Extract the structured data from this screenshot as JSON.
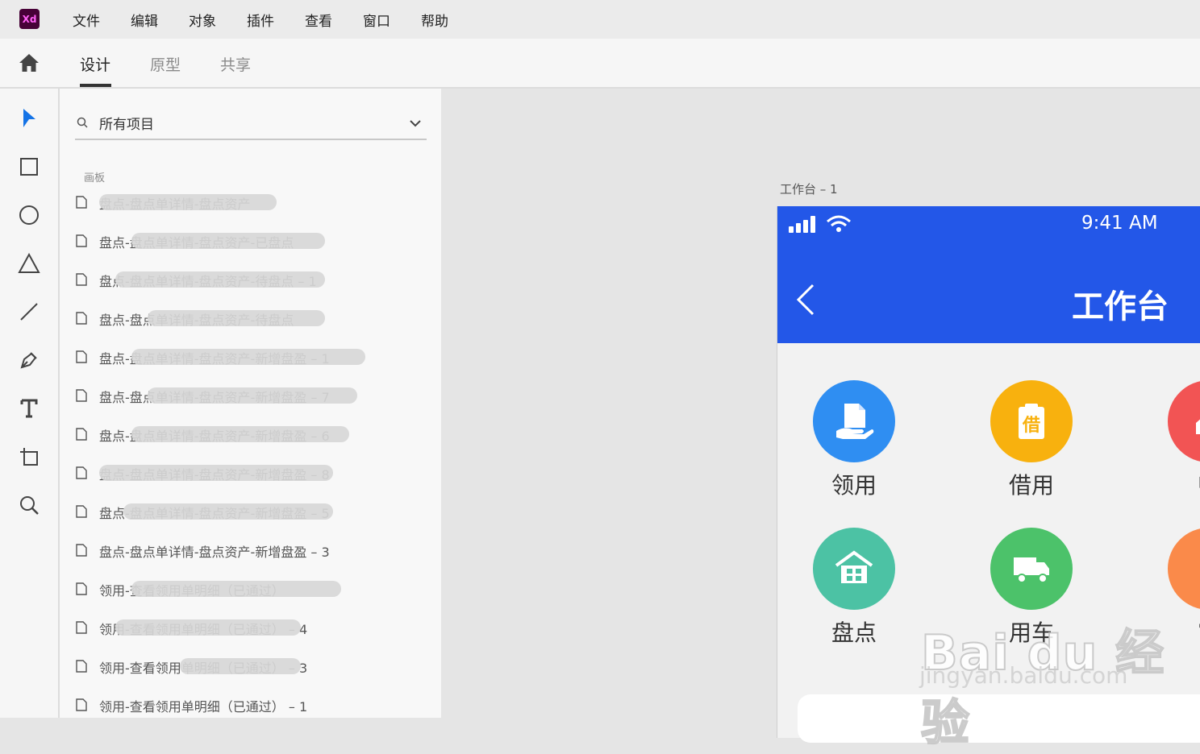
{
  "app": {
    "logo_text": "Xd"
  },
  "menu": [
    "文件",
    "编辑",
    "对象",
    "插件",
    "查看",
    "窗口",
    "帮助"
  ],
  "tabs": [
    {
      "label": "设计",
      "active": true
    },
    {
      "label": "原型",
      "active": false
    },
    {
      "label": "共享",
      "active": false
    }
  ],
  "tools": [
    "select-icon",
    "rectangle-icon",
    "ellipse-icon",
    "triangle-icon",
    "line-icon",
    "pen-icon",
    "text-icon",
    "artboard-icon",
    "zoom-icon"
  ],
  "layers": {
    "search_value": "所有项目",
    "section_label": "画板",
    "items": [
      "盘点-盘点单详情-盘点资产",
      "盘点-盘点单详情-盘点资产-已盘点",
      "盘点-盘点单详情-盘点资产-待盘点 – 1",
      "盘点-盘点单详情-盘点资产-待盘点",
      "盘点-盘点单详情-盘点资产-新增盘盈 – 1",
      "盘点-盘点单详情-盘点资产-新增盘盈 – 7",
      "盘点-盘点单详情-盘点资产-新增盘盈 – 6",
      "盘点-盘点单详情-盘点资产-新增盘盈 – 8",
      "盘点-盘点单详情-盘点资产-新增盘盈 – 5",
      "盘点-盘点单详情-盘点资产-新增盘盈 – 3",
      "领用-查看领用单明细（已通过）",
      "领用-查看领用单明细（已通过） – 4",
      "领用-查看领用单明细（已通过） – 3",
      "领用-查看领用单明细（已通过） – 1"
    ]
  },
  "artboard": {
    "label": "工作台 – 1",
    "status_time": "9:41 AM",
    "title": "工作台",
    "apps": [
      {
        "label": "领用",
        "color": "#2f8ef2",
        "icon": "hand-document-icon"
      },
      {
        "label": "借用",
        "color": "#f8b10e",
        "icon": "borrow-icon"
      },
      {
        "label": "归",
        "color": "#f25454",
        "icon": "return-icon"
      },
      {
        "label": "盘点",
        "color": "#4cc2a4",
        "icon": "warehouse-icon"
      },
      {
        "label": "用车",
        "color": "#4cc26a",
        "icon": "truck-icon"
      },
      {
        "label": "审",
        "color": "#fa8a4a",
        "icon": "approve-icon"
      }
    ]
  },
  "watermark": {
    "main": "Bai du 经验",
    "sub": "jingyan.baidu.com"
  },
  "colors": {
    "accent": "#2357e8",
    "tool_active": "#1473e6"
  }
}
